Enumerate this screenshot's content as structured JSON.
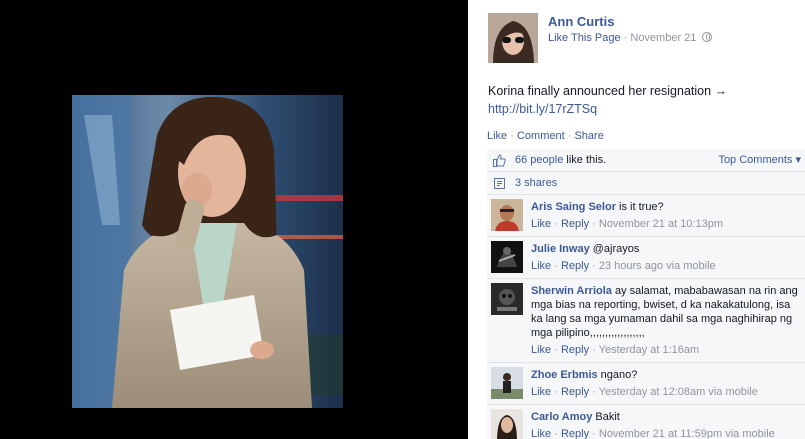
{
  "post": {
    "author": "Ann Curtis",
    "like_page": "Like This Page",
    "date": "November 21",
    "text": "Korina finally announced her resignation →",
    "link": "http://bit.ly/17rZTSq",
    "globe_icon": "globe-icon"
  },
  "actions": {
    "like": "Like",
    "comment": "Comment",
    "share": "Share"
  },
  "ufi": {
    "likes_people": "66 people",
    "likes_suffix": " like this.",
    "top_comments": "Top Comments ▾",
    "shares": "3 shares",
    "like_icon": "thumbs-up-icon",
    "share_icon": "share-icon"
  },
  "comments": [
    {
      "name": "Aris Saing Selor",
      "text": " is it true?",
      "like": "Like",
      "reply": "Reply",
      "time": "November 21 at 10:13pm"
    },
    {
      "name": "Julie Inway",
      "text": " @ajrayos",
      "like": "Like",
      "reply": "Reply",
      "time": "23 hours ago via mobile"
    },
    {
      "name": "Sherwin Arriola",
      "text": " ay salamat, mababawasan na rin ang mga bias na reporting, bwiset, d ka nakakatulong, isa ka lang sa mga yumaman dahil sa mga naghihirap ng mga pilipino,,,,,,,,,,,,,,,,,,",
      "like": "Like",
      "reply": "Reply",
      "time": "Yesterday at 1:16am"
    },
    {
      "name": "Zhoe Erbmis",
      "text": " ngano?",
      "like": "Like",
      "reply": "Reply",
      "time": "Yesterday at 12:08am via mobile"
    },
    {
      "name": "Carlo Amoy",
      "text": " Bakit",
      "like": "Like",
      "reply": "Reply",
      "time": "November 21 at 11:59pm via mobile"
    }
  ],
  "colors": {
    "link": "#3b5998",
    "muted": "#90949c",
    "ufi_bg": "#f6f7f9",
    "stage_bg": "#000000"
  }
}
